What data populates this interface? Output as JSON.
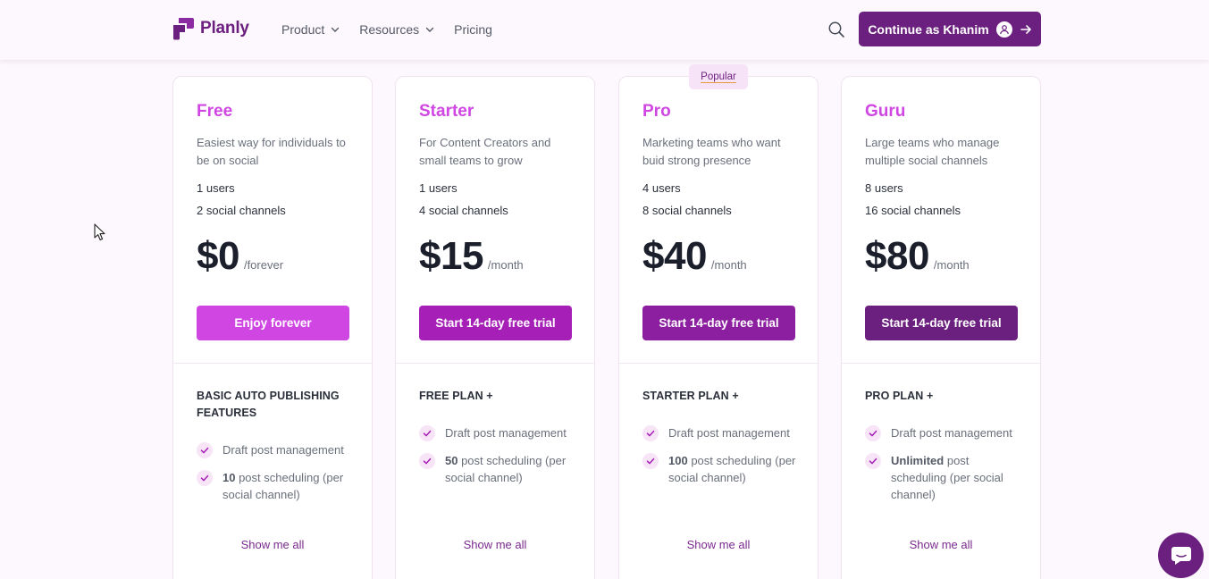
{
  "brand": {
    "name": "Planly",
    "color": "#6b1f7e",
    "accent": "#d046e3"
  },
  "nav": [
    {
      "label": "Product",
      "dropdown": true
    },
    {
      "label": "Resources",
      "dropdown": true
    },
    {
      "label": "Pricing",
      "dropdown": false
    }
  ],
  "header": {
    "search_icon": "search-icon",
    "cta_label": "Continue as Khanim"
  },
  "badge": "Popular",
  "plans": [
    {
      "name": "Free",
      "description": "Easiest way for individuals to be on social",
      "users": "1 users",
      "channels": "2 social channels",
      "price": "$0",
      "period": "/forever",
      "button": "Enjoy forever",
      "button_color": "#d046e3",
      "features_header": "BASIC AUTO PUBLISHING FEATURES",
      "features": [
        {
          "bold": "",
          "text": "Draft post management"
        },
        {
          "bold": "10",
          "text": " post scheduling (per social channel)"
        }
      ],
      "show_all": "Show me all"
    },
    {
      "name": "Starter",
      "description": "For Content Creators and small teams to grow",
      "users": "1 users",
      "channels": "4 social channels",
      "price": "$15",
      "period": "/month",
      "button": "Start 14-day free trial",
      "button_color": "#a620b7",
      "features_header": "FREE PLAN +",
      "features": [
        {
          "bold": "",
          "text": "Draft post management"
        },
        {
          "bold": "50",
          "text": " post scheduling (per social channel)"
        }
      ],
      "show_all": "Show me all"
    },
    {
      "name": "Pro",
      "description": "Marketing teams who want buid strong presence",
      "users": "4 users",
      "channels": "8 social channels",
      "price": "$40",
      "period": "/month",
      "button": "Start 14-day free trial",
      "button_color": "#8c1fa0",
      "features_header": "STARTER PLAN +",
      "features": [
        {
          "bold": "",
          "text": "Draft post management"
        },
        {
          "bold": "100",
          "text": " post scheduling (per social channel)"
        }
      ],
      "show_all": "Show me all"
    },
    {
      "name": "Guru",
      "description": "Large teams who manage multiple social channels",
      "users": "8 users",
      "channels": "16 social channels",
      "price": "$80",
      "period": "/month",
      "button": "Start 14-day free trial",
      "button_color": "#6b1f7e",
      "features_header": "PRO PLAN +",
      "features": [
        {
          "bold": "",
          "text": "Draft post management"
        },
        {
          "bold": "Unlimited",
          "text": " post scheduling (per social channel)"
        }
      ],
      "show_all": "Show me all"
    }
  ]
}
